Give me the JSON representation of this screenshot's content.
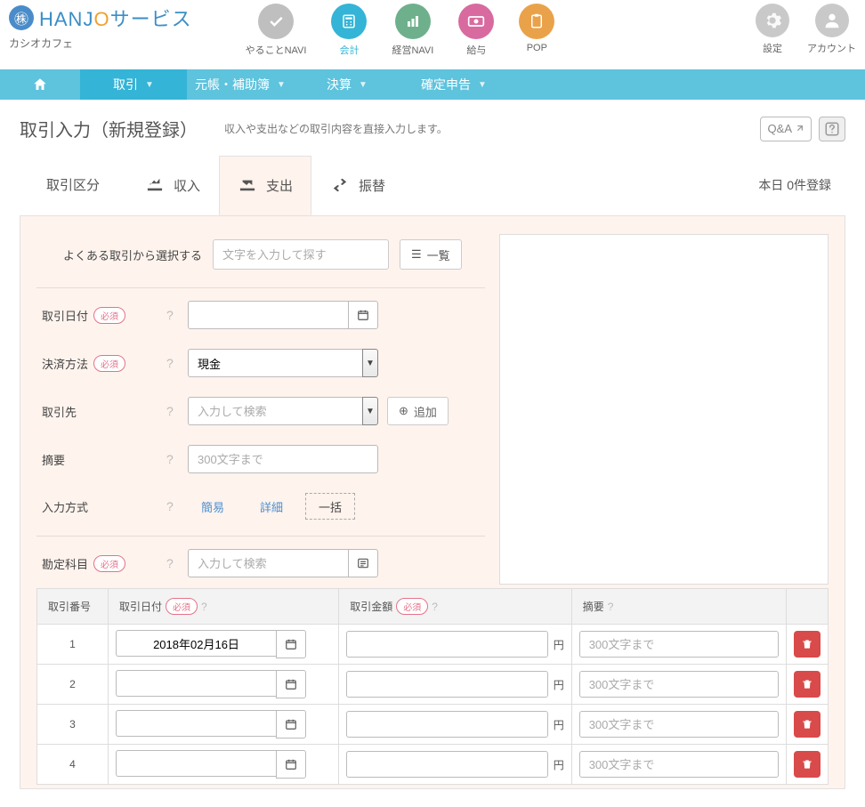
{
  "brand": {
    "name_pre": "HANJ",
    "name_o": "O",
    "name_post": "サービス",
    "sub": "カシオカフェ"
  },
  "apps": [
    {
      "label": "やることNAVI",
      "color": "#bfbfbf"
    },
    {
      "label": "会計",
      "color": "#34b4d6",
      "active": true
    },
    {
      "label": "経営NAVI",
      "color": "#6fb08c"
    },
    {
      "label": "給与",
      "color": "#d86aa0"
    },
    {
      "label": "POP",
      "color": "#eaa24a"
    }
  ],
  "top_controls": {
    "settings": "設定",
    "account": "アカウント"
  },
  "nav": {
    "items": [
      {
        "label": "取引",
        "active": true
      },
      {
        "label": "元帳・補助簿"
      },
      {
        "label": "決算"
      },
      {
        "label": "確定申告"
      }
    ]
  },
  "page": {
    "title": "取引入力（新規登録）",
    "desc": "収入や支出などの取引内容を直接入力します。",
    "qa": "Q&A"
  },
  "type_section": {
    "label": "取引区分",
    "tabs": [
      {
        "label": "収入"
      },
      {
        "label": "支出",
        "active": true
      },
      {
        "label": "振替"
      }
    ],
    "today": "本日 0件登録"
  },
  "search": {
    "label": "よくある取引から選択する",
    "placeholder": "文字を入力して探す",
    "list_btn": "一覧"
  },
  "fields": {
    "date": {
      "label": "取引日付",
      "required": "必須",
      "value": ""
    },
    "payment": {
      "label": "決済方法",
      "required": "必須",
      "value": "現金"
    },
    "partner": {
      "label": "取引先",
      "placeholder": "入力して検索",
      "value": "",
      "add": "追加"
    },
    "summary": {
      "label": "摘要",
      "placeholder": "300文字まで",
      "value": ""
    },
    "mode": {
      "label": "入力方式",
      "options": [
        "簡易",
        "詳細",
        "一括"
      ],
      "active": "一括"
    },
    "account": {
      "label": "勘定科目",
      "required": "必須",
      "placeholder": "入力して検索",
      "value": ""
    }
  },
  "table": {
    "headers": {
      "no": "取引番号",
      "date": "取引日付",
      "amount": "取引金額",
      "summary": "摘要",
      "required": "必須"
    },
    "currency": "円",
    "desc_placeholder": "300文字まで",
    "rows": [
      {
        "no": "1",
        "date": "2018年02月16日",
        "amount": "",
        "summary": ""
      },
      {
        "no": "2",
        "date": "",
        "amount": "",
        "summary": ""
      },
      {
        "no": "3",
        "date": "",
        "amount": "",
        "summary": ""
      },
      {
        "no": "4",
        "date": "",
        "amount": "",
        "summary": ""
      }
    ]
  }
}
